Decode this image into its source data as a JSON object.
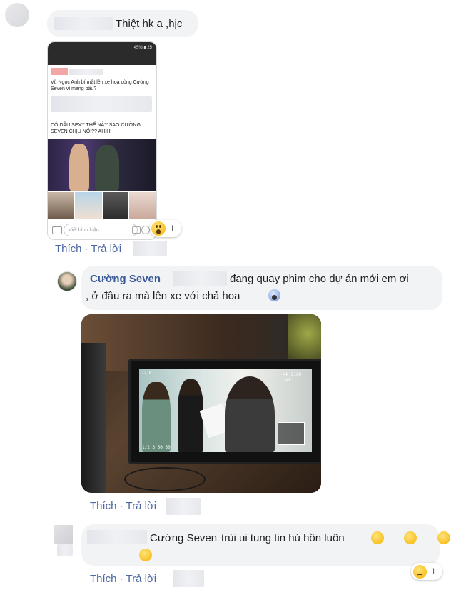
{
  "comment1": {
    "text": "Thiệt hk a ,hjc",
    "phone": {
      "status": "45% ▮ 25",
      "headline1": "Vũ Ngọc Anh bí mật lên xe hoa cùng Cường Seven vì mang bầu?",
      "headline2": "CÔ DÂU SEXY THẾ NÀY SAO CƯỜNG SEVEN CHỊU NỔI?? AHIHI",
      "comment_placeholder": "Viết bình luận...",
      "reaction_count": "1"
    },
    "actions": {
      "like": "Thích",
      "reply": "Trả lời",
      "dot": "·"
    }
  },
  "comment2": {
    "author": "Cường Seven",
    "text_line1": "đang quay phim cho dự án mới em ơi",
    "text_line2": ", ở đâu ra mà lên xe với chả hoa",
    "monitor": {
      "top_left": "72.0",
      "top_right": "4k 2160 24P",
      "bottom": "1/2 3 50 50"
    },
    "actions": {
      "like": "Thích",
      "reply": "Trả lời"
    }
  },
  "comment3": {
    "author_link": "Cường Seven",
    "text": "trùi ui tung tin hú hồn luôn",
    "reaction_count": "1",
    "actions": {
      "like": "Thích",
      "reply": "Trả lời"
    }
  },
  "colors": {
    "link": "#385898",
    "action": "#4b67a1",
    "bubble": "#f2f3f5"
  }
}
